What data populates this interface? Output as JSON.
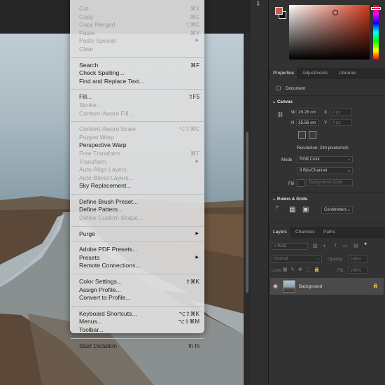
{
  "edit_menu": {
    "items": [
      {
        "label": "Cut",
        "shortcut": "⌘X",
        "enabled": false
      },
      {
        "label": "Copy",
        "shortcut": "⌘C",
        "enabled": false
      },
      {
        "label": "Copy Merged",
        "shortcut": "⇧⌘C",
        "enabled": false
      },
      {
        "label": "Paste",
        "shortcut": "⌘V",
        "enabled": false
      },
      {
        "label": "Paste Special",
        "submenu": true,
        "enabled": false
      },
      {
        "label": "Clear",
        "enabled": false
      },
      {
        "separator": true
      },
      {
        "label": "Search",
        "shortcut": "⌘F",
        "enabled": true
      },
      {
        "label": "Check Spelling...",
        "enabled": true
      },
      {
        "label": "Find and Replace Text...",
        "enabled": true
      },
      {
        "separator": true
      },
      {
        "label": "Fill...",
        "shortcut": "⇧F5",
        "enabled": true
      },
      {
        "label": "Stroke...",
        "enabled": false
      },
      {
        "label": "Content-Aware Fill...",
        "enabled": false
      },
      {
        "separator": true
      },
      {
        "label": "Content-Aware Scale",
        "shortcut": "⌥⇧⌘C",
        "enabled": false
      },
      {
        "label": "Puppet Warp",
        "enabled": false
      },
      {
        "label": "Perspective Warp",
        "enabled": true
      },
      {
        "label": "Free Transform",
        "shortcut": "⌘T",
        "enabled": false
      },
      {
        "label": "Transform",
        "submenu": true,
        "enabled": false
      },
      {
        "label": "Auto-Align Layers...",
        "enabled": false
      },
      {
        "label": "Auto-Blend Layers...",
        "enabled": false
      },
      {
        "label": "Sky Replacement...",
        "enabled": true
      },
      {
        "separator": true
      },
      {
        "label": "Define Brush Preset...",
        "enabled": true
      },
      {
        "label": "Define Pattern...",
        "enabled": true
      },
      {
        "label": "Define Custom Shape...",
        "enabled": false
      },
      {
        "separator": true
      },
      {
        "label": "Purge",
        "submenu": true,
        "enabled": true
      },
      {
        "separator": true
      },
      {
        "label": "Adobe PDF Presets...",
        "enabled": true
      },
      {
        "label": "Presets",
        "submenu": true,
        "enabled": true
      },
      {
        "label": "Remote Connections...",
        "enabled": true
      },
      {
        "separator": true
      },
      {
        "label": "Color Settings...",
        "shortcut": "⇧⌘K",
        "enabled": true
      },
      {
        "label": "Assign Profile...",
        "enabled": true
      },
      {
        "label": "Convert to Profile...",
        "enabled": true
      },
      {
        "separator": true
      },
      {
        "label": "Keyboard Shortcuts...",
        "shortcut": "⌥⇧⌘K",
        "enabled": true
      },
      {
        "label": "Menus...",
        "shortcut": "⌥⇧⌘M",
        "enabled": true
      },
      {
        "label": "Toolbar...",
        "enabled": true
      },
      {
        "separator": true
      },
      {
        "label": "Start Dictation",
        "shortcut": "fn fn",
        "enabled": true
      }
    ]
  },
  "color_panel": {
    "foreground_color": "#c65c4c",
    "background_color": "#111111"
  },
  "properties_tabs": [
    "Properties",
    "Adjustments",
    "Libraries"
  ],
  "properties": {
    "document_label": "Document",
    "canvas_header": "Canvas",
    "w_label": "W",
    "w_value": "29.28 cm",
    "h_label": "H",
    "h_value": "35.56 cm",
    "x_label": "X",
    "x_placeholder": "0 px",
    "y_label": "Y",
    "y_placeholder": "0 px",
    "resolution": "Resolution: 240 pixels/inch",
    "mode_label": "Mode",
    "mode_value": "RGB Color",
    "depth_value": "8 Bits/Channel",
    "fill_label": "Fill",
    "fill_value": "Background Color",
    "rulers_header": "Rulers & Grids",
    "units_value": "Centimeters"
  },
  "layers_tabs": [
    "Layers",
    "Channels",
    "Paths"
  ],
  "layers": {
    "kind_placeholder": "Kind",
    "blend_mode": "Normal",
    "opacity_label": "Opacity:",
    "opacity_value": "100%",
    "lock_label": "Lock:",
    "fill_label": "Fill:",
    "fill_value": "100%",
    "rows": [
      {
        "name": "Background",
        "locked": true,
        "visible": true
      }
    ]
  }
}
